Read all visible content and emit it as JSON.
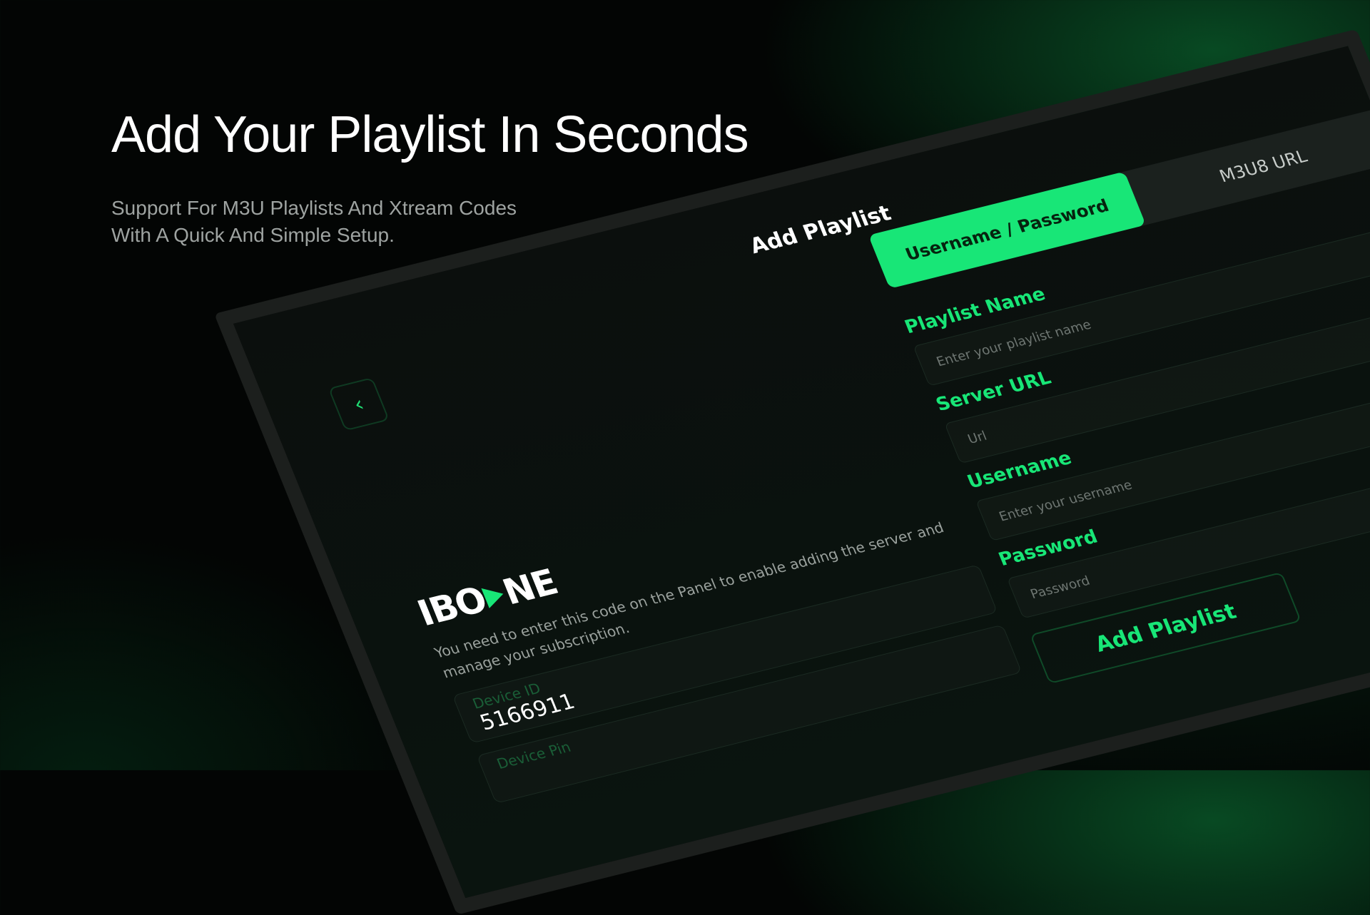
{
  "hero": {
    "title": "Add Your Playlist In Seconds",
    "subtitle_line1": "Support For M3U Playlists And Xtream Codes",
    "subtitle_line2": "With A Quick And Simple Setup."
  },
  "panel": {
    "title": "Add Playlist",
    "back_icon": "chevron-left-icon",
    "tabs": [
      {
        "label": "Username / Password",
        "active": true
      },
      {
        "label": "M3U8 URL",
        "active": false
      }
    ],
    "fields": {
      "playlist_name": {
        "label": "Playlist Name",
        "placeholder": "Enter your playlist name"
      },
      "server_url": {
        "label": "Server URL",
        "placeholder": "Url"
      },
      "username": {
        "label": "Username",
        "placeholder": "Enter your username"
      },
      "password": {
        "label": "Password",
        "placeholder": "Password"
      }
    },
    "submit_label": "Add Playlist"
  },
  "device": {
    "logo_left": "IBO",
    "logo_right": "NE",
    "message": "You need to enter this code on the Panel to enable adding the server and manage your subscription.",
    "device_id_label": "Device ID",
    "device_id_value": "5166911",
    "device_pin_label": "Device Pin"
  },
  "colors": {
    "accent": "#18e677",
    "background": "#030504"
  }
}
